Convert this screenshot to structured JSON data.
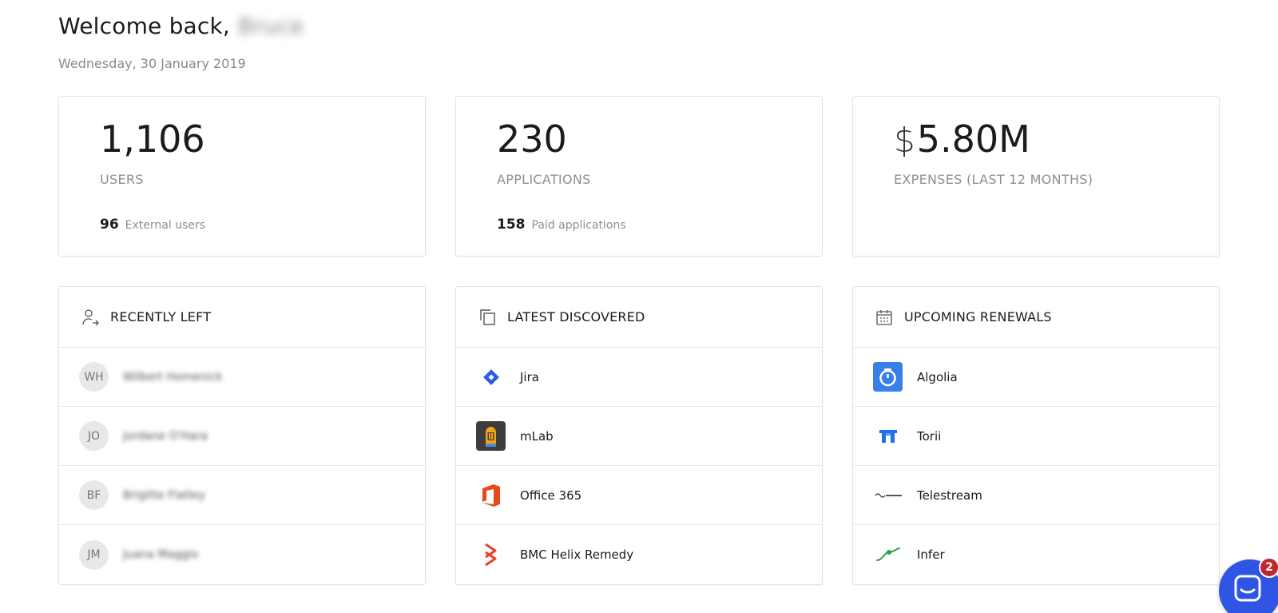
{
  "header": {
    "welcome_prefix": "Welcome back,",
    "user_name": "Bruce",
    "date": "Wednesday, 30 January 2019"
  },
  "stats": {
    "users": {
      "value": "1,106",
      "label": "USERS",
      "sub_value": "96",
      "sub_label": "External users"
    },
    "applications": {
      "value": "230",
      "label": "APPLICATIONS",
      "sub_value": "158",
      "sub_label": "Paid applications"
    },
    "expenses": {
      "currency": "$",
      "value": "5.80M",
      "label": "EXPENSES (LAST 12 MONTHS)"
    }
  },
  "recently_left": {
    "title": "RECENTLY LEFT",
    "icon": "user-exit-icon",
    "items": [
      {
        "initials": "WH",
        "name": "Wilbert Homenick"
      },
      {
        "initials": "JO",
        "name": "Jordane O'Hara"
      },
      {
        "initials": "BF",
        "name": "Brigitte Flatley"
      },
      {
        "initials": "JM",
        "name": "Juana Maggio"
      }
    ]
  },
  "latest_discovered": {
    "title": "LATEST DISCOVERED",
    "icon": "copy-icon",
    "items": [
      {
        "name": "Jira",
        "icon": "jira-logo-icon",
        "color": "#2d5be3"
      },
      {
        "name": "mLab",
        "icon": "mlab-logo-icon",
        "color": "#3d3d3d"
      },
      {
        "name": "Office 365",
        "icon": "office365-logo-icon",
        "color": "#e64a19"
      },
      {
        "name": "BMC Helix Remedy",
        "icon": "bmc-helix-logo-icon",
        "color": "#e8402a"
      }
    ]
  },
  "upcoming_renewals": {
    "title": "UPCOMING RENEWALS",
    "icon": "calendar-icon",
    "items": [
      {
        "name": "Algolia",
        "icon": "algolia-logo-icon",
        "color": "#3a7ee8"
      },
      {
        "name": "Torii",
        "icon": "torii-logo-icon",
        "color": "#1f6fe5"
      },
      {
        "name": "Telestream",
        "icon": "telestream-logo-icon",
        "color": "#333333"
      },
      {
        "name": "Infer",
        "icon": "infer-logo-icon",
        "color": "#2e9e4a"
      }
    ]
  },
  "chat": {
    "badge_count": "2",
    "accent": "#2f55e4",
    "badge_color": "#c0262d"
  }
}
